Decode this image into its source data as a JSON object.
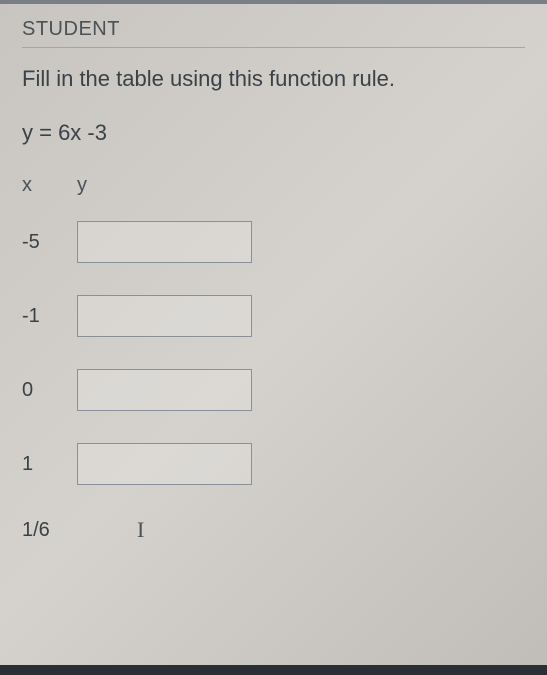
{
  "header": "STUDENT",
  "instruction": "Fill in the table using this function rule.",
  "rule": "y = 6x -3",
  "columns": {
    "x": "x",
    "y": "y"
  },
  "rows": [
    {
      "x": "-5",
      "y": ""
    },
    {
      "x": "-1",
      "y": ""
    },
    {
      "x": "0",
      "y": ""
    },
    {
      "x": "1",
      "y": ""
    },
    {
      "x": "1/6",
      "y": ""
    }
  ],
  "cursor": "I"
}
